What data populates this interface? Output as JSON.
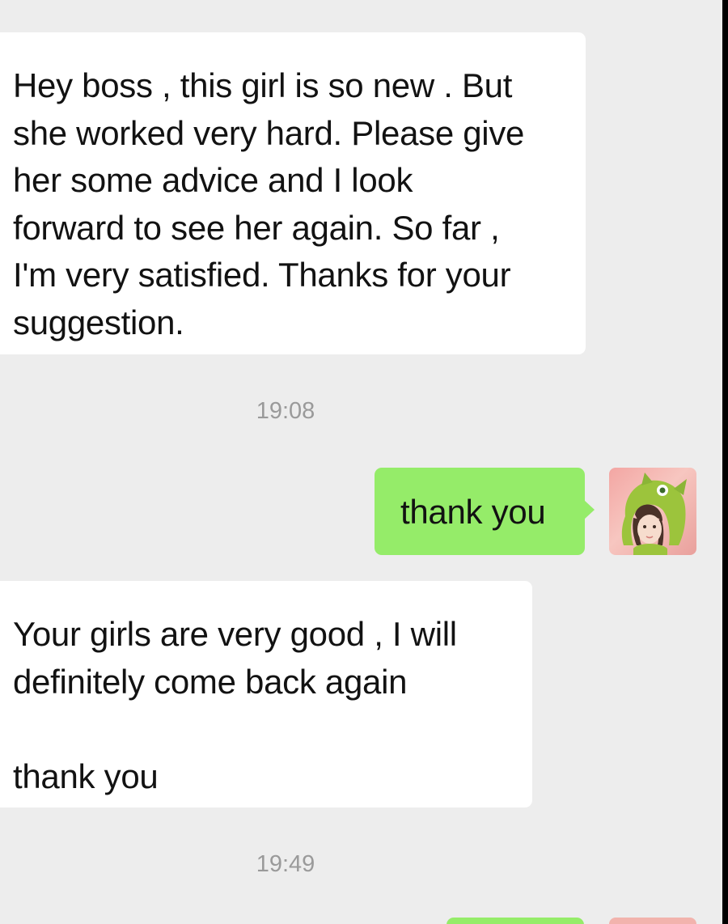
{
  "messages": [
    {
      "direction": "incoming",
      "text": "Hey boss , this girl is so new . But\nshe worked very hard. Please give\nher some advice and I look\nforward to see her again. So far ,\nI'm very satisfied. Thanks for your\nsuggestion."
    },
    {
      "direction": "outgoing",
      "text": "thank you",
      "avatar_icon": "user-avatar-green-hood"
    },
    {
      "direction": "incoming",
      "text": "Your girls are very good , I will\ndefinitely come back again\n\nthank you"
    }
  ],
  "timestamps": [
    "19:08",
    "19:49"
  ],
  "colors": {
    "background": "#ededed",
    "incoming_bubble": "#ffffff",
    "outgoing_bubble": "#95ec69",
    "timestamp_text": "#9a9a9a",
    "message_text": "#121212"
  }
}
